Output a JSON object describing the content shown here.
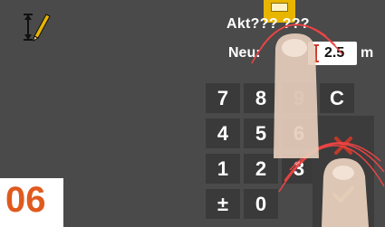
{
  "header": {
    "title": "Akt??? ???",
    "new_label": "Neu:",
    "value": "2.5",
    "unit": "m"
  },
  "keypad": {
    "keys": [
      "7",
      "8",
      "9",
      "C",
      "4",
      "5",
      "6",
      "1",
      "2",
      "3",
      "±",
      "0"
    ]
  },
  "step_badge": "06",
  "icons": {
    "top_left": "height-measure-edit-icon",
    "cancel": "cancel-x-icon",
    "confirm": "confirm-check-icon",
    "finger": "touch-finger-icon"
  },
  "colors": {
    "background": "#4a4a4a",
    "accent": "#e8b500",
    "cancel": "#c0392b",
    "confirm": "#c9c27a",
    "step": "#e05a1e"
  }
}
